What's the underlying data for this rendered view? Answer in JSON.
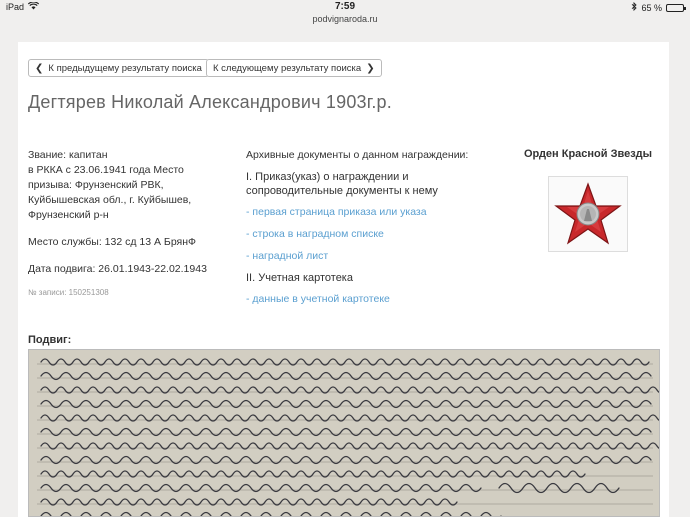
{
  "status": {
    "device": "iPad",
    "time": "7:59",
    "battery": "65 %",
    "battery_level": 0.65,
    "url": "podvignaroda.ru"
  },
  "nav": {
    "prev_label": "К предыдущему результату поиска",
    "next_label": "К следующему результату поиска"
  },
  "person": {
    "title": "Дегтярев Николай Александрович 1903г.р.",
    "rank": "Звание: капитан",
    "service_lines": [
      "в РККА с 23.06.1941 года Место",
      "призыва: Фрунзенский РВК,",
      "Куйбышевская обл., г. Куйбышев,",
      "Фрунзенский р-н"
    ],
    "place": "Место службы: 132 сд 13 А БрянФ",
    "feat_date": "Дата подвига: 26.01.1943-22.02.1943",
    "record_no": "№ записи: 150251308"
  },
  "archive": {
    "heading": "Архивные документы о данном награждении:",
    "section1": "I. Приказ(указ) о награждении и сопроводительные документы к нему",
    "links1": [
      "- первая страница приказа или указа",
      "- строка в наградном списке",
      "- наградной лист"
    ],
    "section2": "II. Учетная картотека",
    "links2": [
      "- данные в учетной картотеке"
    ]
  },
  "award": {
    "name": "Орден Красной Звезды"
  },
  "feat": {
    "label": "Подвиг:"
  }
}
